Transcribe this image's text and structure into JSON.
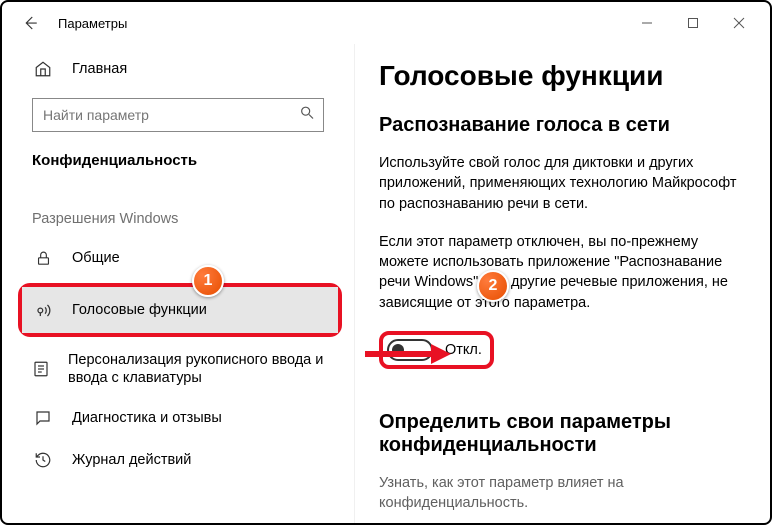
{
  "window": {
    "title": "Параметры"
  },
  "sidebar": {
    "home": "Главная",
    "search_placeholder": "Найти параметр",
    "group": "Конфиденциальность",
    "section": "Разрешения Windows",
    "items": [
      {
        "label": "Общие"
      },
      {
        "label": "Голосовые функции"
      },
      {
        "label": "Персонализация рукописного ввода и ввода с клавиатуры"
      },
      {
        "label": "Диагностика и отзывы"
      },
      {
        "label": "Журнал действий"
      }
    ]
  },
  "content": {
    "h1": "Голосовые функции",
    "h2": "Распознавание голоса в сети",
    "p1": "Используйте свой голос для диктовки и других приложений, применяющих технологию Майкрософт по распознаванию речи в сети.",
    "p2": "Если этот параметр отключен, вы по-прежнему можете использовать приложение \"Распознавание речи Windows\" или другие речевые приложения, не зависящие от этого параметра.",
    "toggle_label": "Откл.",
    "h2b": "Определить свои параметры конфиденциальности",
    "sub": "Узнать, как этот параметр влияет на конфиденциальность."
  },
  "badges": {
    "b1": "1",
    "b2": "2"
  }
}
